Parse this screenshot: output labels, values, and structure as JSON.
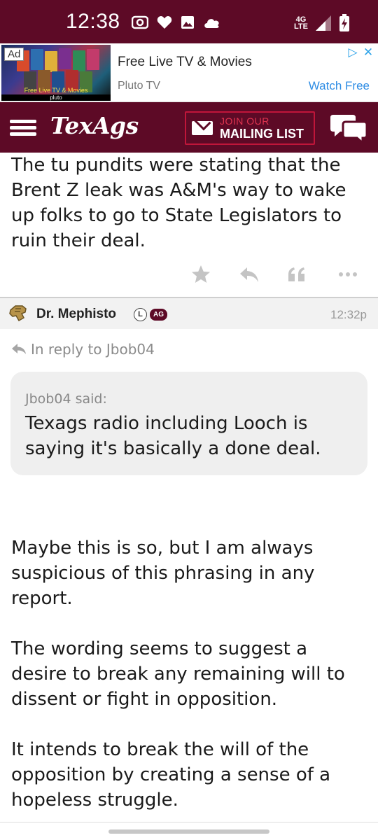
{
  "status_bar": {
    "time": "12:38",
    "network_top": "4G",
    "network_bottom": "LTE",
    "battery_level_percent": 60,
    "icons": [
      "radio-icon",
      "heart-icon",
      "image-icon",
      "cloud-icon",
      "signal-icon",
      "battery-charging-icon"
    ]
  },
  "ad": {
    "badge": "Ad",
    "title": "Free Live TV & Movies",
    "advertiser": "Pluto TV",
    "cta": "Watch Free",
    "thumb_caption": "Free Live TV & Movies",
    "thumb_brand": "pluto",
    "choices_icons": [
      "adchoices-icon",
      "close-icon"
    ]
  },
  "header": {
    "logo": "TexAgs",
    "mailing_line1": "JOIN OUR",
    "mailing_line2": "MAILING LIST",
    "colors": {
      "maroon": "#5d0a26",
      "accent_red": "#c0163a"
    }
  },
  "post1": {
    "body": "The tu pundits were stating that the Brent Z leak was A&M's way to wake up folks to go to State Legislators to ruin their deal.",
    "actions": [
      "star-icon",
      "reply-icon",
      "quote-icon",
      "more-icon"
    ]
  },
  "post2": {
    "author": "Dr. Mephisto",
    "badge_l": "L",
    "badge_ag": "AG",
    "time": "12:32p",
    "reply_to": "In reply to Jbob04",
    "quote": {
      "by": "Jbob04 said:",
      "text": "Texags radio including Looch is saying it's basically a done deal."
    },
    "paragraphs": [
      "Maybe this is so, but I am always suspicious of this phrasing in any report.",
      "The wording seems to suggest a desire to break any remaining will to dissent or fight in opposition.",
      "It intends to break the will of the opposition by creating a sense of a hopeless struggle."
    ]
  }
}
